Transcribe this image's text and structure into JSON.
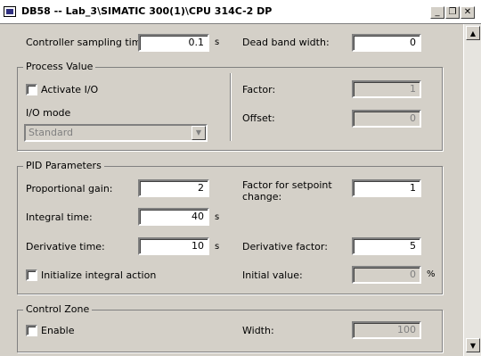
{
  "window": {
    "title": "DB58 -- Lab_3\\SIMATIC 300(1)\\CPU 314C-2 DP",
    "icon": "db-block-icon",
    "minimize": "_",
    "restore": "❐",
    "close": "✕"
  },
  "top": {
    "sampling_label": "Controller sampling time:",
    "sampling_value": "0.1",
    "sampling_unit": "s",
    "deadband_label": "Dead band width:",
    "deadband_value": "0"
  },
  "process_value": {
    "title": "Process Value",
    "activate_io_label": "Activate I/O",
    "activate_io_checked": false,
    "io_mode_label": "I/O mode",
    "io_mode_value": "Standard",
    "factor_label": "Factor:",
    "factor_value": "1",
    "offset_label": "Offset:",
    "offset_value": "0"
  },
  "pid": {
    "title": "PID Parameters",
    "prop_gain_label": "Proportional gain:",
    "prop_gain_value": "2",
    "setpoint_factor_label": "Factor for setpoint change:",
    "setpoint_factor_value": "1",
    "integral_time_label": "Integral time:",
    "integral_time_value": "40",
    "integral_time_unit": "s",
    "derivative_time_label": "Derivative time:",
    "derivative_time_value": "10",
    "derivative_time_unit": "s",
    "derivative_factor_label": "Derivative factor:",
    "derivative_factor_value": "5",
    "init_integral_label": "Initialize integral action",
    "init_integral_checked": false,
    "initial_value_label": "Initial value:",
    "initial_value_value": "0",
    "initial_value_unit": "%"
  },
  "control_zone": {
    "title": "Control Zone",
    "enable_label": "Enable",
    "enable_checked": false,
    "width_label": "Width:",
    "width_value": "100"
  },
  "scrollbar": {
    "up": "▲",
    "down": "▼"
  }
}
